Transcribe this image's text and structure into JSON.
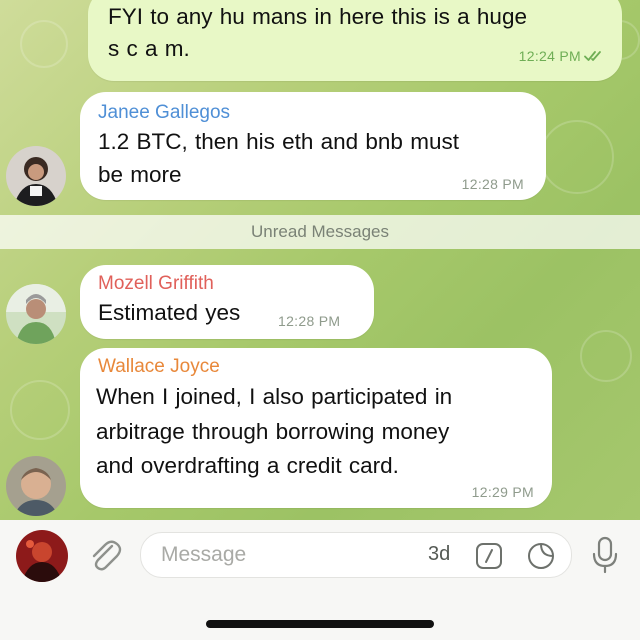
{
  "messages": [
    {
      "id": "m1",
      "direction": "outgoing",
      "text_line1": "FYI to any hu mans in here this is a huge",
      "text_line2": "s c a m.",
      "time": "12:24 PM",
      "status": "read-double-check"
    },
    {
      "id": "m2",
      "direction": "incoming",
      "sender": "Janee Gallegos",
      "sender_color": "#4f8fd6",
      "text_line1": "1.2 BTC, then his eth and bnb must",
      "text_line2": "be more",
      "time": "12:28 PM"
    },
    {
      "id": "m3",
      "direction": "incoming",
      "sender": "Mozell Griffith",
      "sender_color": "#e0605a",
      "text_line1": "Estimated yes",
      "time": "12:28 PM"
    },
    {
      "id": "m4",
      "direction": "incoming",
      "sender": "Wallace Joyce",
      "sender_color": "#e8883a",
      "text_line1": "When I joined, I also participated in",
      "text_line2": "arbitrage through borrowing money",
      "text_line3": "and overdrafting a credit card.",
      "time": "12:29 PM"
    }
  ],
  "divider": {
    "label": "Unread Messages"
  },
  "composer": {
    "placeholder": "Message",
    "timer_label": "3d",
    "attach_icon": "paperclip-icon",
    "command_icon": "slash-command-icon",
    "sticker_icon": "sticker-icon",
    "mic_icon": "microphone-icon"
  },
  "colors": {
    "outgoing_bubble": "#e8f8c6",
    "incoming_bubble": "#ffffff",
    "read_check": "#6fae55",
    "wallpaper": "#a6c86a"
  }
}
